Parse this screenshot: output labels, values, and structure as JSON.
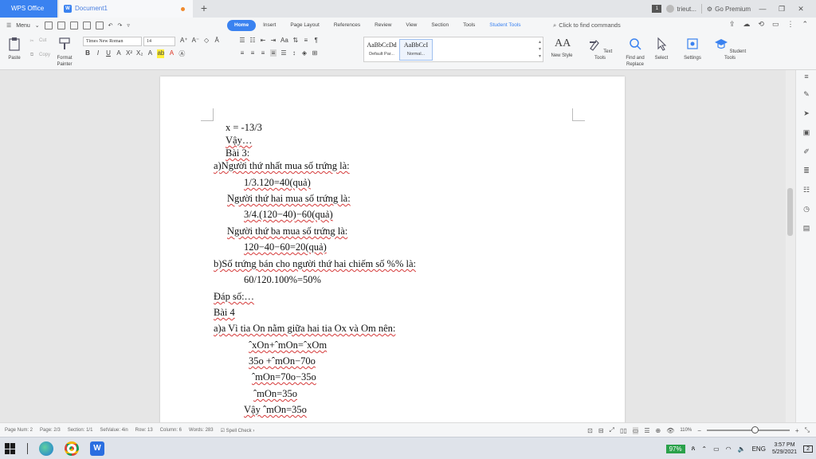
{
  "window": {
    "app_tab": "WPS Office",
    "doc_tab": "Document1",
    "new_tab": "+",
    "badge": "1",
    "user": "trieut...",
    "premium": "Go Premium"
  },
  "menubar": {
    "menu_label": "Menu",
    "tabs": [
      "Home",
      "Insert",
      "Page Layout",
      "References",
      "Review",
      "View",
      "Section",
      "Tools",
      "Student Tools"
    ],
    "find_command": "Click to find commands"
  },
  "ribbon": {
    "paste": "Paste",
    "cut": "Cut",
    "copy": "Copy",
    "format_painter_1": "Format",
    "format_painter_2": "Painter",
    "font_name": "Times New Roman",
    "font_size": "14",
    "styles": [
      {
        "sample": "AaBbCcDd",
        "name": "Default Par..."
      },
      {
        "sample": "AaBbCcI",
        "name": "Normal..."
      }
    ],
    "new_style": "New Style",
    "text_tools": "Text Tools",
    "find_replace_1": "Find and",
    "find_replace_2": "Replace",
    "select": "Select",
    "settings": "Settings",
    "student_tools": "Student Tools"
  },
  "document": {
    "lines": [
      "x                  = -13/3",
      "Vậy…",
      "Bài 3:",
      "a)Người thứ nhất mua số trứng là:",
      "1/3.120=40(quả)",
      "Người thứ hai mua số trứng là:",
      "3/4.(120−40)−60(quả)",
      "Người thứ ba mua số trứng là:",
      "120−40−60=20(quả)",
      "b)Số trứng bán cho người thứ hai chiếm số %% là:",
      "60/120.100%=50%",
      "Đáp số:…",
      "Bài 4",
      "a)a Vì tia On nằm giữa hai tia Ox và Om nên:",
      "ˆxOn+ˆmOn=ˆxOm",
      "35o   +ˆmOn−70o",
      "ˆmOn=70o−35o",
      "ˆmOn=35o",
      "Vậy ˆmOn=35o"
    ]
  },
  "statusbar": {
    "page_num": "Page Num: 2",
    "page": "Page: 2/3",
    "section": "Section: 1/1",
    "setvalue": "SetValue: 4in",
    "row": "Row: 13",
    "column": "Column: 6",
    "words": "Words: 283",
    "spell": "Spell Check",
    "zoom": "110%"
  },
  "taskbar": {
    "battery": "97%",
    "lang": "ENG",
    "time": "3:57 PM",
    "date": "5/29/2021",
    "notif": "2"
  },
  "colors": {
    "accent": "#3a82f0",
    "spell_underline": "#d53a3a"
  }
}
